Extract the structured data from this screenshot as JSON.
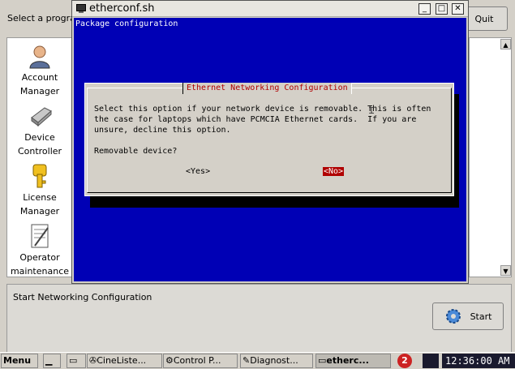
{
  "background_app": {
    "top_label": "Select a program",
    "quit_label": "Quit",
    "side_items": [
      {
        "line1": "Account",
        "line2": "Manager",
        "icon": "user-icon"
      },
      {
        "line1": "Device",
        "line2": "Controller",
        "icon": "drive-icon"
      },
      {
        "line1": "License",
        "line2": "Manager",
        "icon": "key-icon"
      },
      {
        "line1": "Operator",
        "line2": "maintenance",
        "icon": "document-icon"
      }
    ],
    "description": "Start Networking Configuration",
    "start_label": "Start"
  },
  "terminal": {
    "title": "etherconf.sh",
    "header": "Package configuration",
    "dialog": {
      "title": "Ethernet Networking Configuration",
      "message": "Select this option if your network device is removable. This is often\nthe case for laptops which have PCMCIA Ethernet cards.  If you are\nunsure, decline this option.",
      "question": "Removable device?",
      "yes_label": "<Yes>",
      "no_label": "<No>"
    }
  },
  "taskbar": {
    "menu_label": "Menu",
    "tasks": [
      "",
      "CineListe...",
      "Control P...",
      "Diagnost...",
      "etherc..."
    ],
    "notification_count": "2",
    "clock": "12:36:00 AM"
  },
  "colors": {
    "terminal_bg": "#0000b5",
    "dialog_accent": "#b00000"
  }
}
